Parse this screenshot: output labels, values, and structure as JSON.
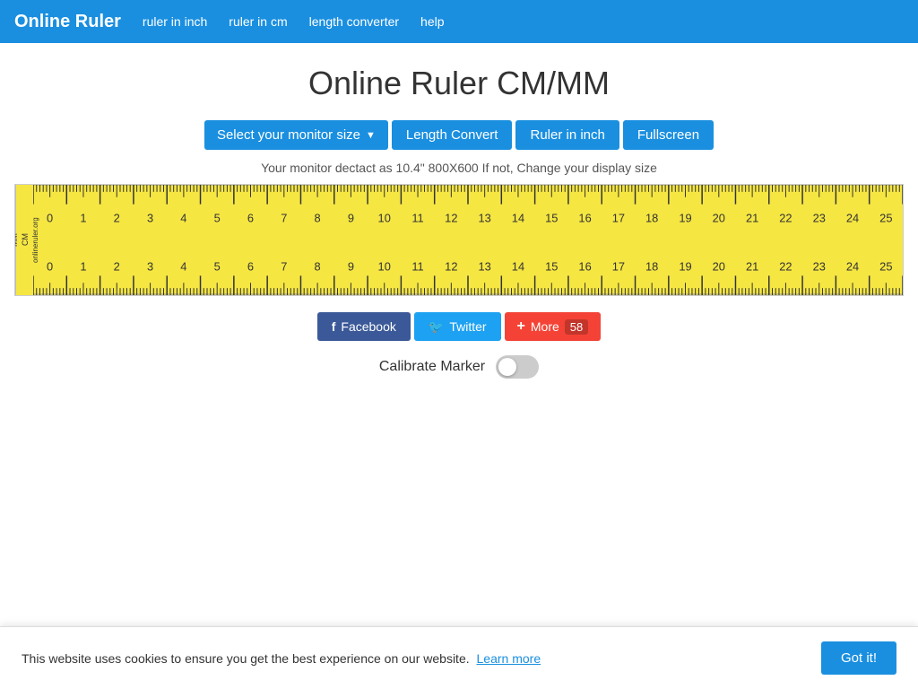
{
  "navbar": {
    "brand": "Online Ruler",
    "links": [
      {
        "label": "ruler in inch",
        "href": "#"
      },
      {
        "label": "ruler in cm",
        "href": "#"
      },
      {
        "label": "length converter",
        "href": "#"
      },
      {
        "label": "help",
        "href": "#"
      }
    ]
  },
  "page": {
    "title": "Online Ruler CM/MM",
    "monitor_info": "Your monitor dectact as 10.4\" 800X600 If not, Change your display size"
  },
  "buttons": {
    "monitor": "Select your monitor size",
    "length_convert": "Length Convert",
    "ruler_in_inch": "Ruler in inch",
    "fullscreen": "Fullscreen"
  },
  "ruler": {
    "side_labels": [
      "MM",
      "CM",
      "onlineruler.org"
    ],
    "cm_marks": [
      0,
      1,
      2,
      3,
      4,
      5,
      6,
      7,
      8,
      9,
      10,
      11,
      12,
      13,
      14,
      15,
      16,
      17,
      18,
      19,
      20,
      21,
      22,
      23,
      24,
      25
    ]
  },
  "social": {
    "facebook_label": "Facebook",
    "twitter_label": "Twitter",
    "more_label": "More",
    "more_count": "58"
  },
  "calibrate": {
    "label": "Calibrate Marker"
  },
  "cookie": {
    "text": "This website uses cookies to ensure you get the best experience on our website.",
    "learn_more": "Learn more",
    "got_it": "Got it!"
  }
}
